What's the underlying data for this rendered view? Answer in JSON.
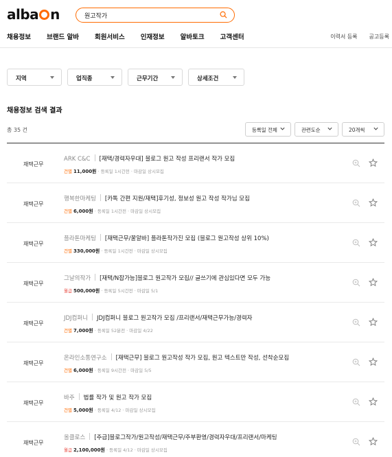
{
  "header": {
    "logo_part1": "alba",
    "logo_part2": "n",
    "search_value": "원고작가",
    "nav": [
      "채용정보",
      "브랜드 알바",
      "회원서비스",
      "인재정보",
      "알바토크",
      "고객센터"
    ],
    "util": [
      "이력서 등록",
      "공고등록"
    ]
  },
  "filters": [
    "지역",
    "업직종",
    "근무기간",
    "상세조건"
  ],
  "results": {
    "title": "채용정보 검색 결과",
    "total": "총 35 건",
    "sort": [
      "등록일 전체",
      "관련도순",
      "20개씩"
    ]
  },
  "jobs": [
    {
      "type": "재택근무",
      "company": "ARK C&C",
      "title": "[재택/경력자우대] 블로그 원고 작성 프리랜서 작가 모집",
      "pay_type": "건별",
      "pay": "11,000원",
      "meta": " · 등록일 1시간전 · 마감일 상시모집"
    },
    {
      "type": "재택근무",
      "company": "행복한마케팅",
      "title": "[카톡 간편 지원/재택]후기성, 정보성 원고 작성 작가님 모집",
      "pay_type": "건별",
      "pay": "6,000원",
      "meta": " · 등록일 1시간전 · 마감일 상시모집"
    },
    {
      "type": "재택근무",
      "company": "플라톤마케팅",
      "title": "[재택근무/꿀알바] 플라톤작가진 모집 (블로그 원고작성 상위 10%)",
      "pay_type": "건별",
      "pay": "330,000원",
      "meta": " · 등록일 1시간전 · 마감일 상시모집"
    },
    {
      "type": "재택근무",
      "company": "그날의작가",
      "title": "[재택/N잡가능]블로그 원고작가 모집// 글쓰기에 관심있다면 모두 가능",
      "pay_type": "월급",
      "pay": "500,000원",
      "meta": " · 등록일 5시간전 · 마감일 5/1"
    },
    {
      "type": "재택근무",
      "company": "JDJ컴퍼니",
      "title": "JDJ컴퍼니 블로그 원고작가 모집 /프리랜서/재택근무가능/경력자",
      "pay_type": "건별",
      "pay": "7,000원",
      "meta": " · 등록일 52분전 · 마감일 4/22"
    },
    {
      "type": "재택근무",
      "company": "온라인소통연구소",
      "title": "[재택근무] 블로그 원고작성 작가 모집, 원고 텍스트만 작성, 선착순모집",
      "pay_type": "건별",
      "pay": "6,000원",
      "meta": " · 등록일 9시간전 · 마감일 5/5"
    },
    {
      "type": "재택근무",
      "company": "바주",
      "title": "법률 작가 및 원고 작가 모집",
      "pay_type": "건별",
      "pay": "5,000원",
      "meta": " · 등록일 4/12 · 마감일 상시모집"
    },
    {
      "type": "재택근무",
      "company": "올클로스",
      "title": "[주급]블로그작가/원고작성/재택근무/주부환영/경력자우대/프리랜서/마케팅",
      "pay_type": "월급",
      "pay": "2,100,000원",
      "meta": " · 등록일 4/12 · 마감일 상시모집"
    }
  ],
  "colors": {
    "accent": "#ff6b00",
    "monthly": "#e8453c"
  }
}
